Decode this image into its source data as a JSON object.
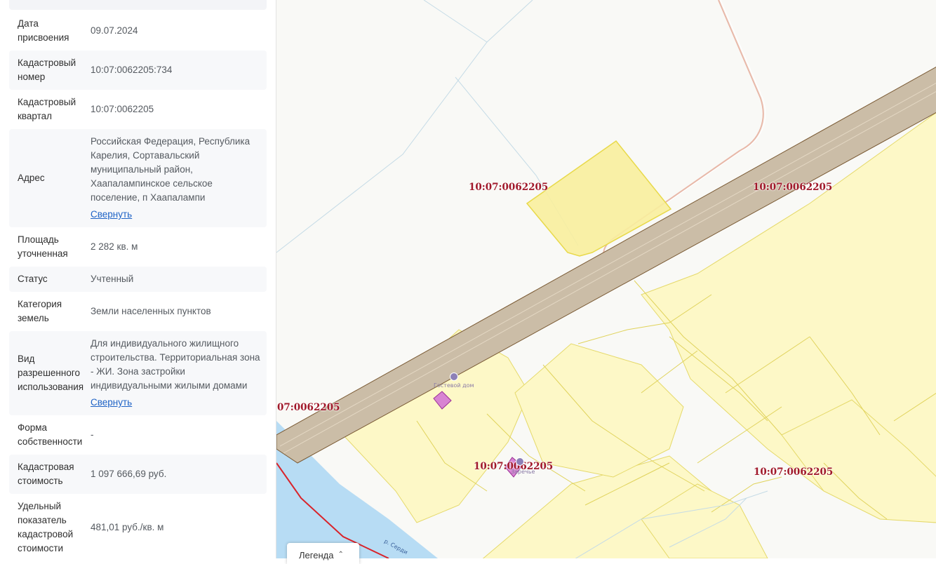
{
  "colors": {
    "link": "#1f63c6",
    "cadastral_label": "#a0182a",
    "parcel_fill": "#fdf8c7",
    "selected_parcel": "#f8ee9d",
    "road": "#cbbda7",
    "water": "#b7dcf4",
    "boundary": "#d9232a",
    "building": "#d883d2"
  },
  "info_rows": [
    {
      "key": "Дата присвоения",
      "value": "09.07.2024",
      "shaded": false
    },
    {
      "key": "Кадастровый номер",
      "value": "10:07:0062205:734",
      "shaded": true
    },
    {
      "key": "Кадастровый квартал",
      "value": "10:07:0062205",
      "shaded": false
    },
    {
      "key": "Адрес",
      "value": "Российская Федерация, Республика Карелия, Сортавальский муниципальный район, Хаапалампинское сельское поселение, п Хаапалампи",
      "link": "Свернуть",
      "shaded": true
    },
    {
      "key": "Площадь уточненная",
      "value": "2 282 кв. м",
      "shaded": false
    },
    {
      "key": "Статус",
      "value": "Учтенный",
      "shaded": true
    },
    {
      "key": "Категория земель",
      "value": "Земли населенных пунктов",
      "shaded": false
    },
    {
      "key": "Вид разрешенного использования",
      "value": "Для индивидуального жилищного строительства. Территориальная зона - ЖИ. Зона застройки индивидуальными жилыми домами",
      "link": "Свернуть",
      "shaded": true
    },
    {
      "key": "Форма собственности",
      "value": "-",
      "shaded": false
    },
    {
      "key": "Кадастровая стоимость",
      "value": "1 097 666,69 руб.",
      "shaded": true
    },
    {
      "key": "Удельный показатель кадастровой стоимости",
      "value": "481,01 руб./кв. м",
      "shaded": false
    }
  ],
  "map": {
    "quarter_labels": [
      "10:07:0062205",
      "10:07:0062205",
      "07:0062205",
      "10:07:0062205",
      "10:07:0062205"
    ],
    "poi": [
      {
        "name": "Гостевой дом",
        "icon": "guest-house-icon"
      },
      {
        "name": "Заречье",
        "icon": "settlement-icon"
      }
    ],
    "river_label": "р. Серди",
    "legend_label": "Легенда",
    "legend_icon": "chevron-up-icon"
  }
}
